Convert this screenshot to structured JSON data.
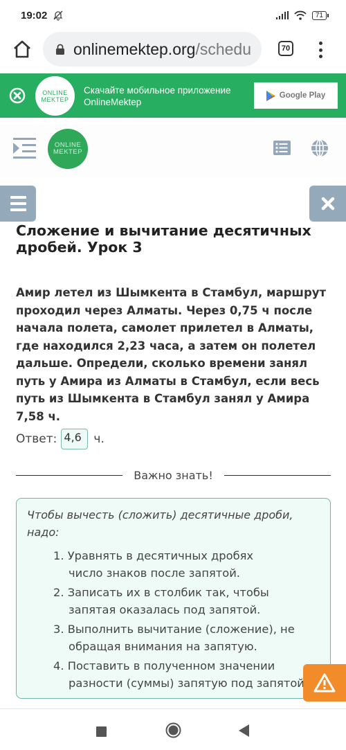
{
  "status_bar": {
    "time": "19:02",
    "battery": "71",
    "icons": [
      "bell-off-icon",
      "signal-icon",
      "wifi-icon",
      "battery-icon"
    ]
  },
  "browser": {
    "url_host": "onlinemektep.org",
    "url_path": "/schedu",
    "tab_count": "70"
  },
  "app_banner": {
    "logo_line1": "ONLINE",
    "logo_line2": "MEKTEP",
    "line1": "Скачайте мобильное приложение",
    "line2": "OnlineMektep",
    "store_button": "Google Play"
  },
  "site_header": {
    "logo_line1": "ONLINE",
    "logo_line2": "MEKTEP"
  },
  "lesson": {
    "title": "Сложение и вычитание десятичных дробей. Урок 3",
    "task": "Амир летел из Шымкента в Стамбул, маршрут проходил через Алматы. Через 0,75 ч после начала полета, самолет прилетел в Алматы, где находился 2,23 часа, а затем он полетел дальше. Определи, сколько времени занял путь у Амира из Алматы в Стамбул, если весь путь из Шымкента в Стамбул занял у Амира 7,58 ч.",
    "answer_label": "Ответ:",
    "answer_value": "4,6",
    "answer_unit": "ч."
  },
  "important": {
    "heading": "Важно знать!",
    "lead": "Чтобы вычесть (сложить) десятичные дроби, надо:",
    "steps": [
      "1. Уравнять в десятичных дробях число знаков после запятой.",
      "2. Записать их в столбик так, чтобы запятая оказалась под запятой.",
      "3. Выполнить вычитание (сложение), не обращая внимания на запятую.",
      "4. Поставить в полученном значении разности (суммы) запятую под запятой"
    ]
  },
  "colors": {
    "brand_green": "#27ae60",
    "toolbar_gray": "#94a9ba",
    "warning_orange": "#f28c2b",
    "info_border": "#6fb5a9",
    "info_bg": "#effbf7"
  }
}
